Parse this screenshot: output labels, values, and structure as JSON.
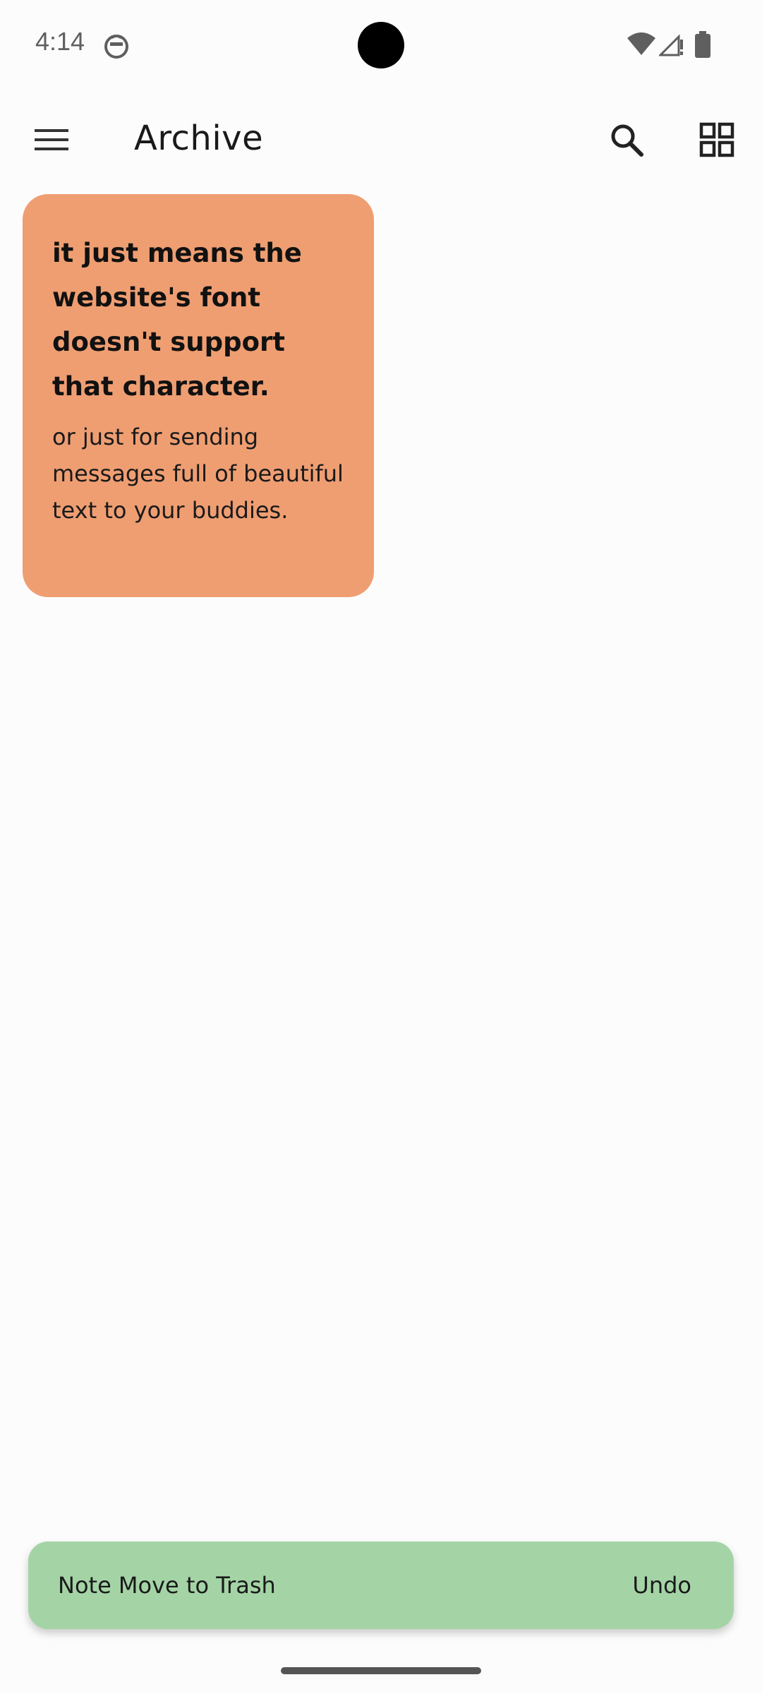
{
  "status_bar": {
    "time": "4:14",
    "app_icon": "cat-face-icon",
    "wifi_icon": "wifi-icon",
    "signal_icon": "cellular-signal-icon",
    "battery_icon": "battery-icon"
  },
  "app_bar": {
    "title": "Archive",
    "menu_icon": "hamburger-menu-icon",
    "search_icon": "search-icon",
    "layout_icon": "grid-view-icon"
  },
  "notes": [
    {
      "title": "it just means the website's font doesn't support that character.",
      "body": "or just for sending messages full of beautiful text to your buddies.",
      "color": "#ef9e72"
    }
  ],
  "snackbar": {
    "message": "Note Move to Trash",
    "action": "Undo",
    "color": "#a4d4a6"
  },
  "colors": {
    "background": "#fdfcfc",
    "text": "#1a1a1a"
  }
}
